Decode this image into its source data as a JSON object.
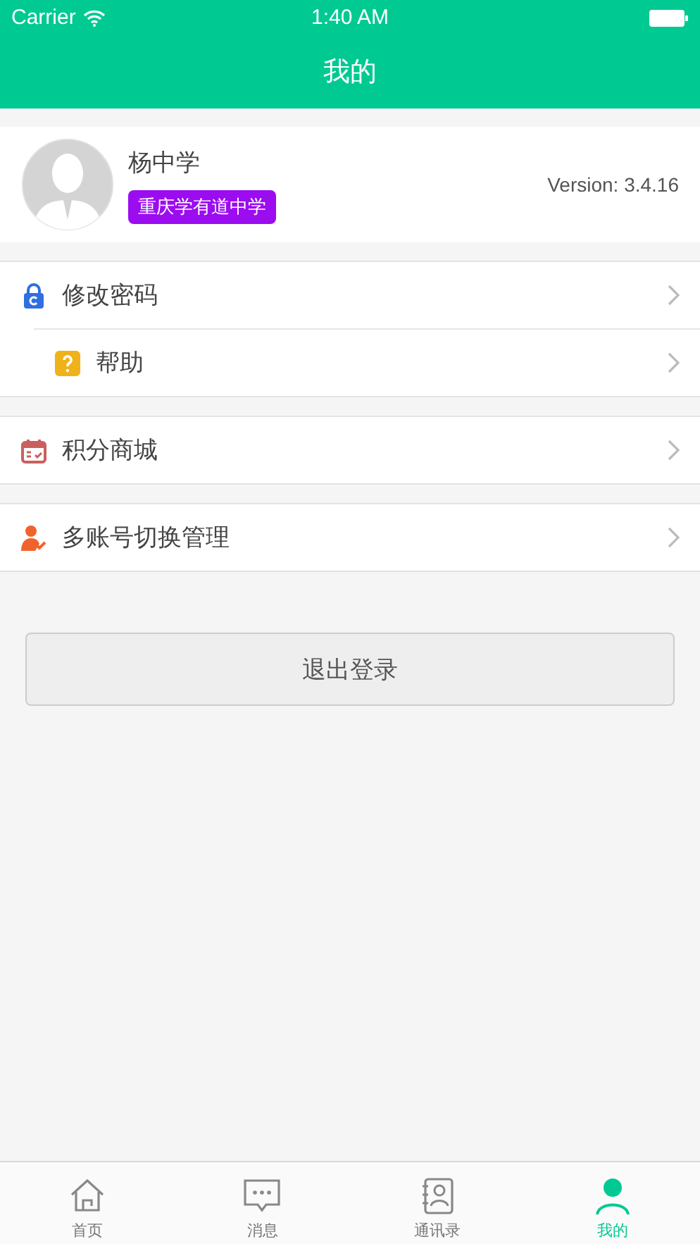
{
  "status_bar": {
    "carrier": "Carrier",
    "time": "1:40 AM"
  },
  "nav": {
    "title": "我的"
  },
  "profile": {
    "name": "杨中学",
    "school": "重庆学有道中学",
    "version": "Version: 3.4.16"
  },
  "menu_groups": [
    {
      "items": [
        {
          "kind": "lock",
          "label": "修改密码"
        },
        {
          "kind": "help",
          "label": "帮助"
        }
      ]
    },
    {
      "items": [
        {
          "kind": "calendar",
          "label": "积分商城"
        }
      ]
    },
    {
      "items": [
        {
          "kind": "account",
          "label": "多账号切换管理"
        }
      ]
    }
  ],
  "logout_button": "退出登录",
  "tabs": [
    {
      "kind": "home",
      "label": "首页",
      "selected": false
    },
    {
      "kind": "message",
      "label": "消息",
      "selected": false
    },
    {
      "kind": "contacts",
      "label": "通讯录",
      "selected": false
    },
    {
      "kind": "me",
      "label": "我的",
      "selected": true
    }
  ]
}
